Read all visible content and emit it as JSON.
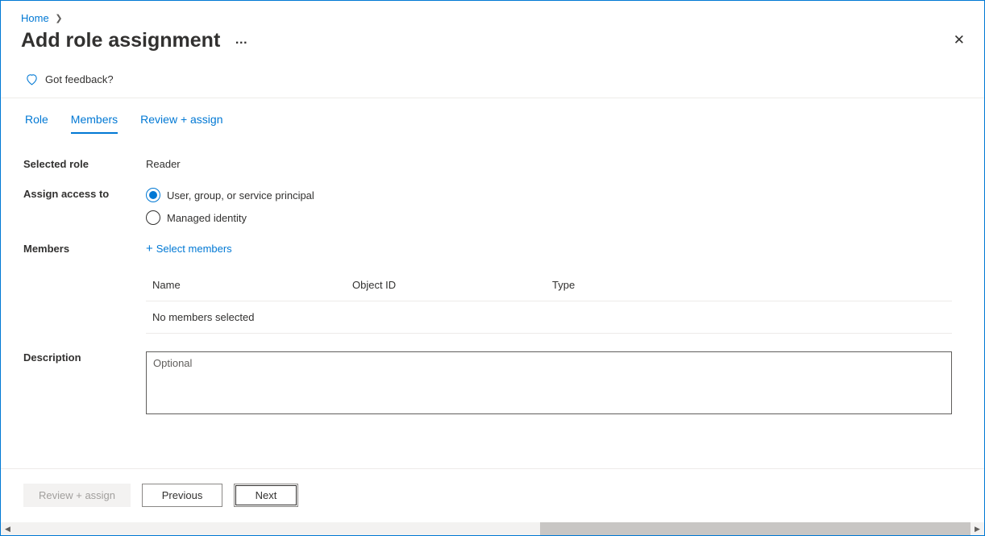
{
  "breadcrumb": {
    "home": "Home"
  },
  "header": {
    "title": "Add role assignment"
  },
  "feedback": {
    "label": "Got feedback?"
  },
  "tabs": {
    "role": "Role",
    "members": "Members",
    "review_assign": "Review + assign"
  },
  "form": {
    "selected_role_label": "Selected role",
    "selected_role_value": "Reader",
    "assign_access_label": "Assign access to",
    "radio_user_group": "User, group, or service principal",
    "radio_managed_identity": "Managed identity",
    "members_label": "Members",
    "select_members_link": "Select members",
    "table_header_name": "Name",
    "table_header_objectid": "Object ID",
    "table_header_type": "Type",
    "table_empty_text": "No members selected",
    "description_label": "Description",
    "description_placeholder": "Optional"
  },
  "footer": {
    "review_assign": "Review + assign",
    "previous": "Previous",
    "next": "Next"
  }
}
